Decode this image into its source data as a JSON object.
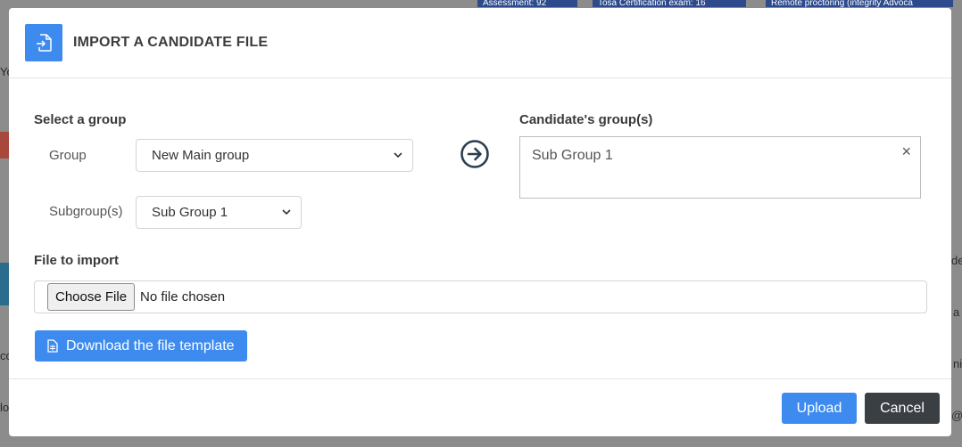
{
  "background": {
    "pills": [
      "Assessment: 92",
      "Tosa Certification exam: 16",
      "Remote proctoring (integrity Advoca"
    ],
    "left_fragments": [
      "Yo",
      "co",
      "lo"
    ],
    "right_fragments": [
      "de",
      "a",
      "ni",
      "@t"
    ]
  },
  "modal": {
    "title": "IMPORT A CANDIDATE FILE",
    "header_icon": "file-import-icon",
    "select_group_label": "Select a group",
    "group_label": "Group",
    "group_value": "New Main group",
    "subgroup_label": "Subgroup(s)",
    "subgroup_value": "Sub Group 1",
    "arrow_icon": "arrow-right-circle-icon",
    "candidate_groups_label": "Candidate's group(s)",
    "candidate_groups_value": "Sub Group 1",
    "clear_symbol": "×",
    "file_to_import_label": "File to import",
    "choose_file_label": "Choose File",
    "no_file_text": "No file chosen",
    "download_label": "Download the file template",
    "download_icon": "spreadsheet-file-icon",
    "upload_label": "Upload",
    "cancel_label": "Cancel"
  },
  "colors": {
    "accent": "#3e8bf0",
    "dark_button": "#3a3f44",
    "overlay": "#8c8c8c"
  }
}
